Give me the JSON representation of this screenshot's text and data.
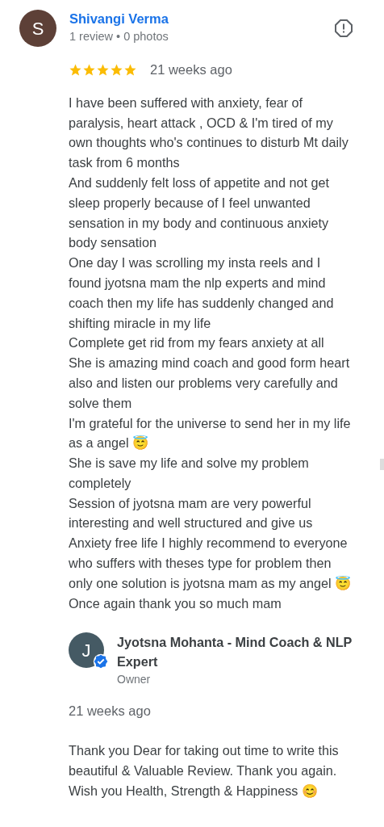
{
  "review": {
    "avatar_letter": "S",
    "author": "Shivangi Verma",
    "meta": "1 review • 0 photos",
    "stars": 5,
    "time": "21 weeks ago",
    "paragraphs": [
      "I have been suffered with anxiety, fear of paralysis, heart attack , OCD & I'm tired of my own thoughts who's continues to disturb Mt daily task from 6 months",
      "And suddenly felt loss of appetite and not get sleep properly because of I feel unwanted sensation in my body and continuous anxiety body sensation",
      "One day I was scrolling my insta reels and I found jyotsna mam the nlp experts and mind coach then my life has suddenly changed and shifting miracle in my life",
      "Complete get rid from my fears anxiety at all",
      "She is amazing mind coach and good form heart also and listen our problems very carefully and solve them",
      "I'm grateful for the universe to send her in my life as a angel 😇",
      "She is save my life and solve my problem completely",
      "Session of jyotsna mam are very powerful interesting and well structured and give us",
      "Anxiety free life I highly recommend to everyone who suffers with theses type for problem then only one solution is jyotsna mam as my angel 😇",
      "Once again thank you so much mam"
    ]
  },
  "reply": {
    "avatar_letter": "J",
    "verified": true,
    "author": "Jyotsna Mohanta - Mind Coach & NLP Expert",
    "role": "Owner",
    "time": "21 weeks ago",
    "text": "Thank you Dear for taking out time to write this beautiful & Valuable Review. Thank you again. Wish you Health, Strength & Happiness 😊"
  }
}
